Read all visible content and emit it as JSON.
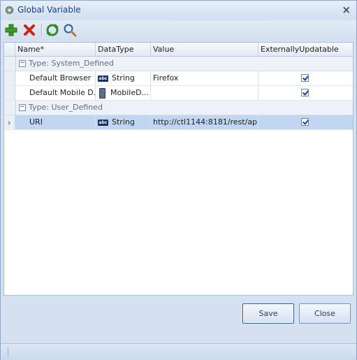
{
  "window": {
    "title": "Global Variable",
    "close_glyph": "×"
  },
  "toolbar": {
    "icons": [
      "add-icon",
      "delete-icon",
      "refresh-icon",
      "search-icon"
    ]
  },
  "grid": {
    "columns": [
      "Name*",
      "DataType",
      "Value",
      "ExternallyUpdatable"
    ],
    "groups": [
      {
        "label": "Type: System_Defined",
        "rows": [
          {
            "name": "Default Browser",
            "datatype": "String",
            "datatype_icon": "abc-icon",
            "value": "Firefox",
            "externally_updatable": true
          },
          {
            "name": "Default Mobile D...",
            "datatype": "MobileD...",
            "datatype_icon": "mobile-device-icon",
            "value": "",
            "externally_updatable": true
          }
        ]
      },
      {
        "label": "Type: User_Defined",
        "rows": [
          {
            "name": "URI",
            "datatype": "String",
            "datatype_icon": "abc-icon",
            "value": "http://ctl1144:8181/rest/ap...",
            "externally_updatable": true,
            "selected": true
          }
        ]
      }
    ],
    "abc_glyph": "abc",
    "row_pointer": "›"
  },
  "buttons": {
    "save": "Save",
    "close": "Close"
  },
  "colors": {
    "title_text": "#15428b",
    "selection": "#c0d6f1",
    "window_bg": "#d5e1f0"
  }
}
